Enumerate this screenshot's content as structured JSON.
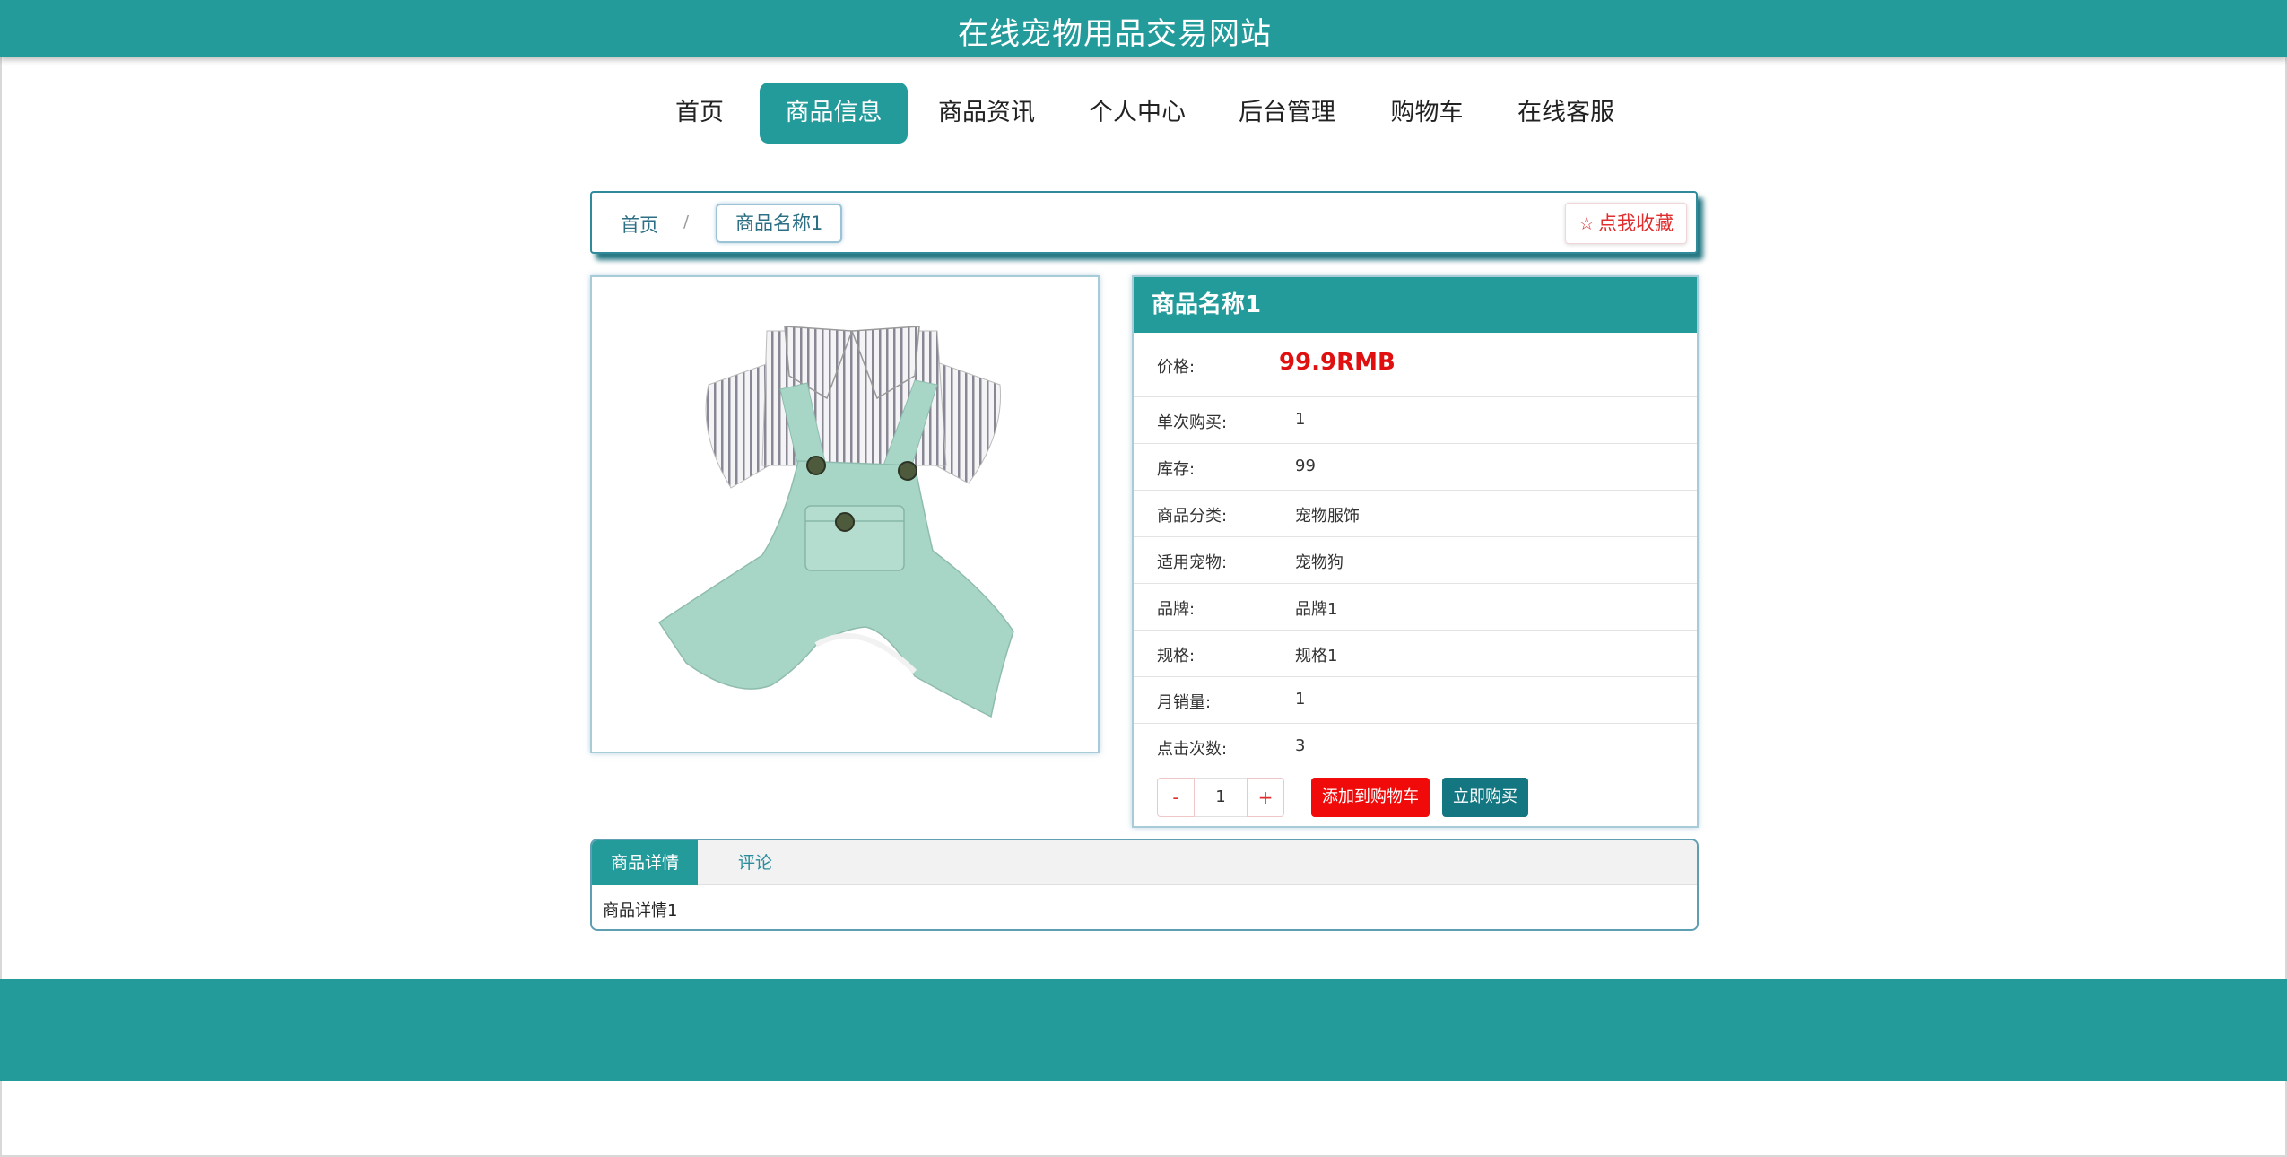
{
  "site": {
    "title": "在线宠物用品交易网站"
  },
  "nav": {
    "items": [
      {
        "label": "首页"
      },
      {
        "label": "商品信息"
      },
      {
        "label": "商品资讯"
      },
      {
        "label": "个人中心"
      },
      {
        "label": "后台管理"
      },
      {
        "label": "购物车"
      },
      {
        "label": "在线客服"
      }
    ],
    "active": "商品信息"
  },
  "breadcrumb": {
    "home": "首页",
    "separator": "/",
    "current": "商品名称1"
  },
  "favorite": {
    "label": "点我收藏",
    "icon": "star-outline-icon"
  },
  "product": {
    "name": "商品名称1",
    "image": "pet-overalls-image",
    "price_label": "价格:",
    "price": "99.9RMB",
    "attributes": [
      {
        "label": "单次购买:",
        "value": "1"
      },
      {
        "label": "库存:",
        "value": "99"
      },
      {
        "label": "商品分类:",
        "value": "宠物服饰"
      },
      {
        "label": "适用宠物:",
        "value": "宠物狗"
      },
      {
        "label": "品牌:",
        "value": "品牌1"
      },
      {
        "label": "规格:",
        "value": "规格1"
      },
      {
        "label": "月销量:",
        "value": "1"
      },
      {
        "label": "点击次数:",
        "value": "3"
      }
    ]
  },
  "purchase": {
    "minus": "-",
    "quantity": "1",
    "plus": "+",
    "add_to_cart": "添加到购物车",
    "buy_now": "立即购买"
  },
  "tabs": {
    "detail": "商品详情",
    "comments": "评论",
    "content": "商品详情1"
  },
  "colors": {
    "primary": "#239b9b",
    "price": "#e01010",
    "cart_button": "#f00a0a",
    "buy_button": "#137680"
  }
}
